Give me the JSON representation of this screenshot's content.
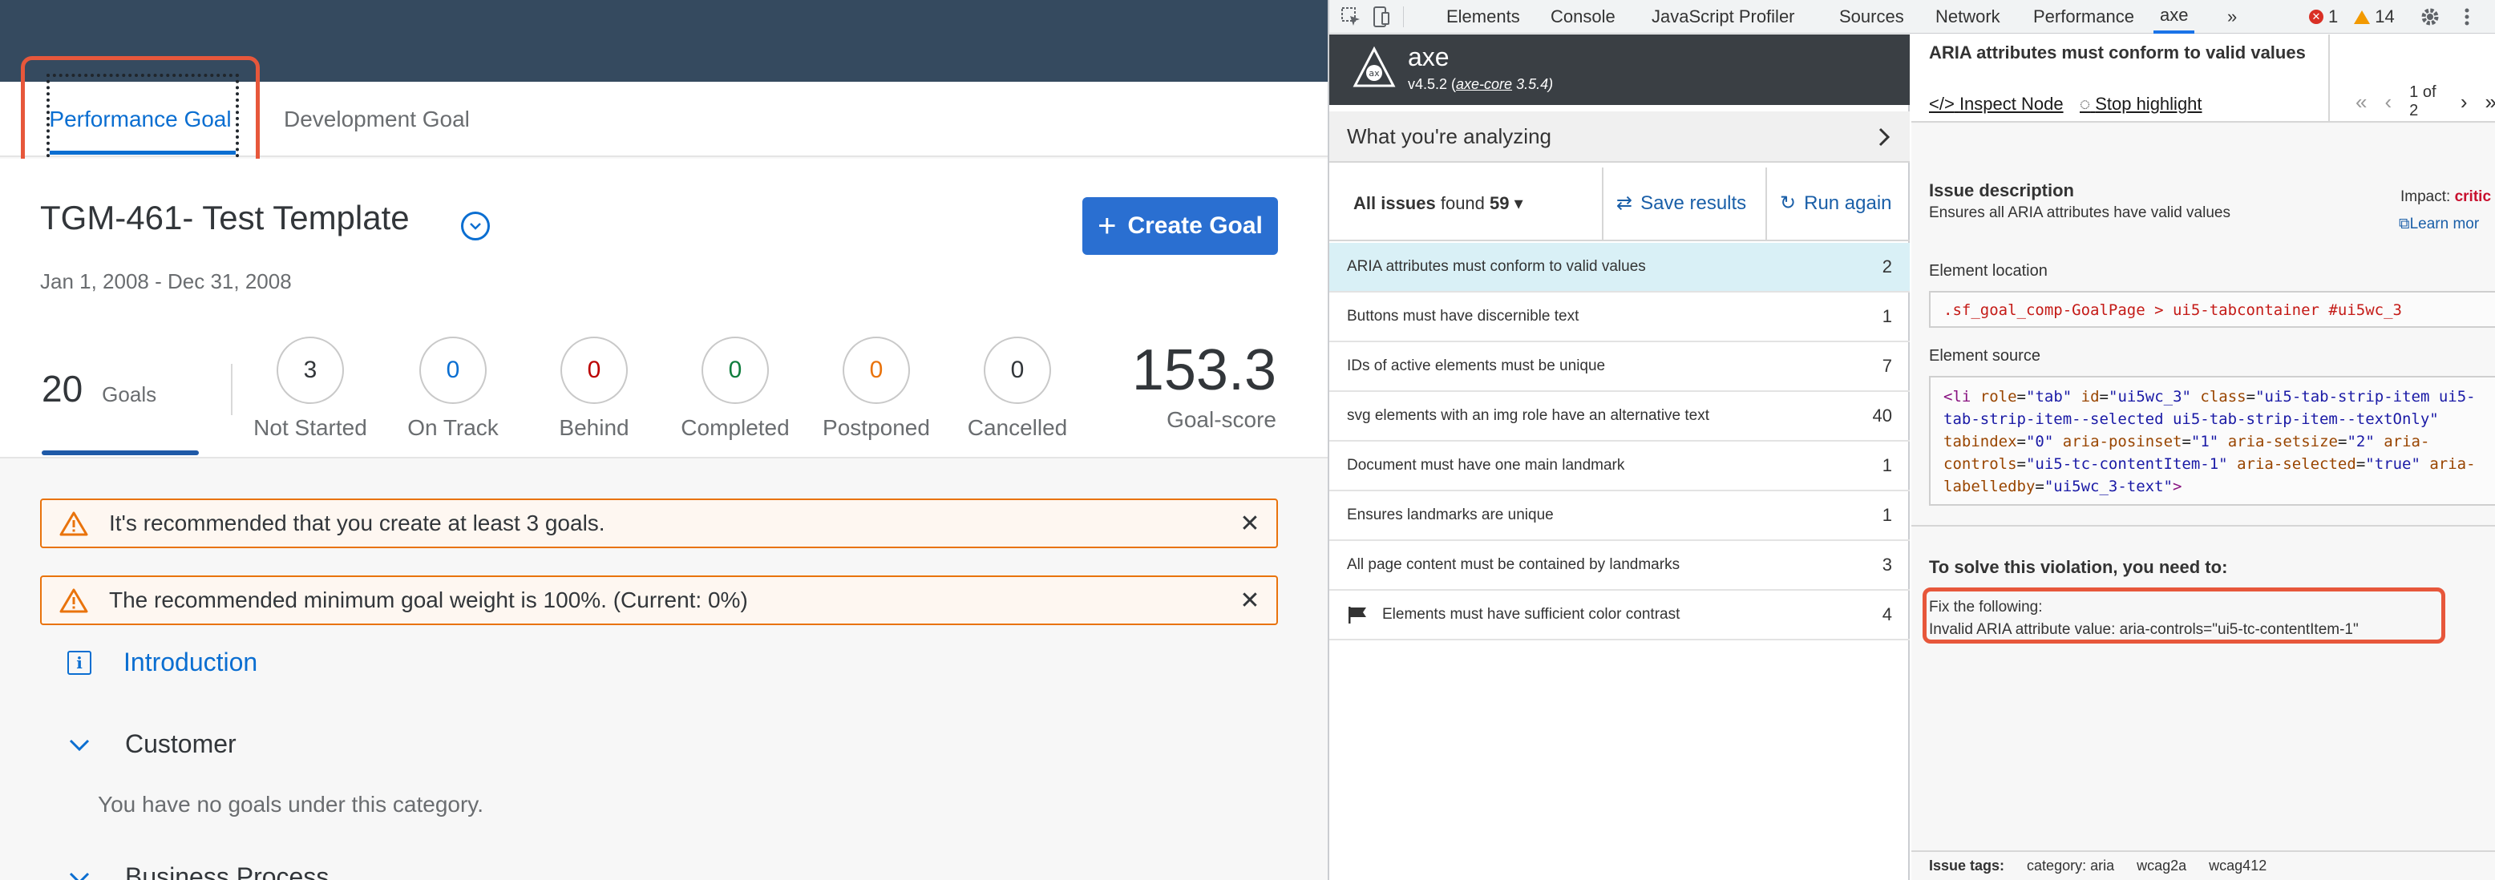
{
  "app": {
    "tabs": [
      "Performance Goal",
      "Development Goal"
    ],
    "template_title": "TGM-461- Test Template",
    "date_range": "Jan 1, 2008 - Dec 31, 2008",
    "create_goal_label": "Create Goal",
    "goals_count": "20",
    "goals_label": "Goals",
    "stats": [
      {
        "value": "3",
        "label": "Not Started",
        "color": "#32363a"
      },
      {
        "value": "0",
        "label": "On Track",
        "color": "#0a6ed1"
      },
      {
        "value": "0",
        "label": "Behind",
        "color": "#bb0000"
      },
      {
        "value": "0",
        "label": "Completed",
        "color": "#107e3e"
      },
      {
        "value": "0",
        "label": "Postponed",
        "color": "#e9730c"
      },
      {
        "value": "0",
        "label": "Cancelled",
        "color": "#32363a"
      }
    ],
    "score_value": "153.3",
    "score_label": "Goal-score",
    "warnings": [
      "It's recommended that you create at least 3 goals.",
      "The recommended minimum goal weight is 100%. (Current: 0%)"
    ],
    "sections": {
      "introduction": "Introduction",
      "customer": "Customer",
      "no_goals": "You have no goals under this category.",
      "business_process": "Business Process"
    },
    "colors": {
      "shell": "#354a5f",
      "accent": "#0a6ed1",
      "highlight": "#e7573b",
      "warning": "#e9730c"
    }
  },
  "devtools": {
    "tabs": [
      "Elements",
      "Console",
      "JavaScript Profiler",
      "Sources",
      "Network",
      "Performance",
      "axe",
      "»"
    ],
    "error_count": "1",
    "warning_count": "14",
    "axe": {
      "name": "axe",
      "version_prefix": "v4.5.2 (",
      "core_link": "axe-core",
      "core_version": " 3.5.4)",
      "analyzing_label": "What you're analyzing",
      "all_issues_label": "All issues",
      "found_label": "found",
      "found_count": "59",
      "save_results": "Save results",
      "run_again": "Run again",
      "issues": [
        {
          "label": "ARIA attributes must conform to valid values",
          "count": "2"
        },
        {
          "label": "Buttons must have discernible text",
          "count": "1"
        },
        {
          "label": "IDs of active elements must be unique",
          "count": "7"
        },
        {
          "label": "svg elements with an img role have an alternative text",
          "count": "40"
        },
        {
          "label": "Document must have one main landmark",
          "count": "1"
        },
        {
          "label": "Ensures landmarks are unique",
          "count": "1"
        },
        {
          "label": "All page content must be contained by landmarks",
          "count": "3"
        },
        {
          "label": "Elements must have sufficient color contrast",
          "count": "4"
        }
      ],
      "detail": {
        "rule_title": "ARIA attributes must conform to valid values",
        "inspect_node": "Inspect Node",
        "stop_highlight": "Stop highlight",
        "pager_text": "1 of 2",
        "issue_description_label": "Issue description",
        "issue_description": "Ensures all ARIA attributes have valid values",
        "impact_label": "Impact:",
        "impact_value": "critic",
        "learn_more": "Learn mor",
        "element_location_label": "Element location",
        "element_location": ".sf_goal_comp-GoalPage > ui5-tabcontainer #ui5wc_3",
        "element_source_label": "Element source",
        "solve_title": "To solve this violation, you need to:",
        "fix_label": "Fix the following:",
        "fix_detail": "Invalid ARIA attribute value: aria-controls=\"ui5-tc-contentItem-1\"",
        "tags_label": "Issue tags:",
        "tags": [
          "category: aria",
          "wcag2a",
          "wcag412"
        ]
      }
    }
  }
}
